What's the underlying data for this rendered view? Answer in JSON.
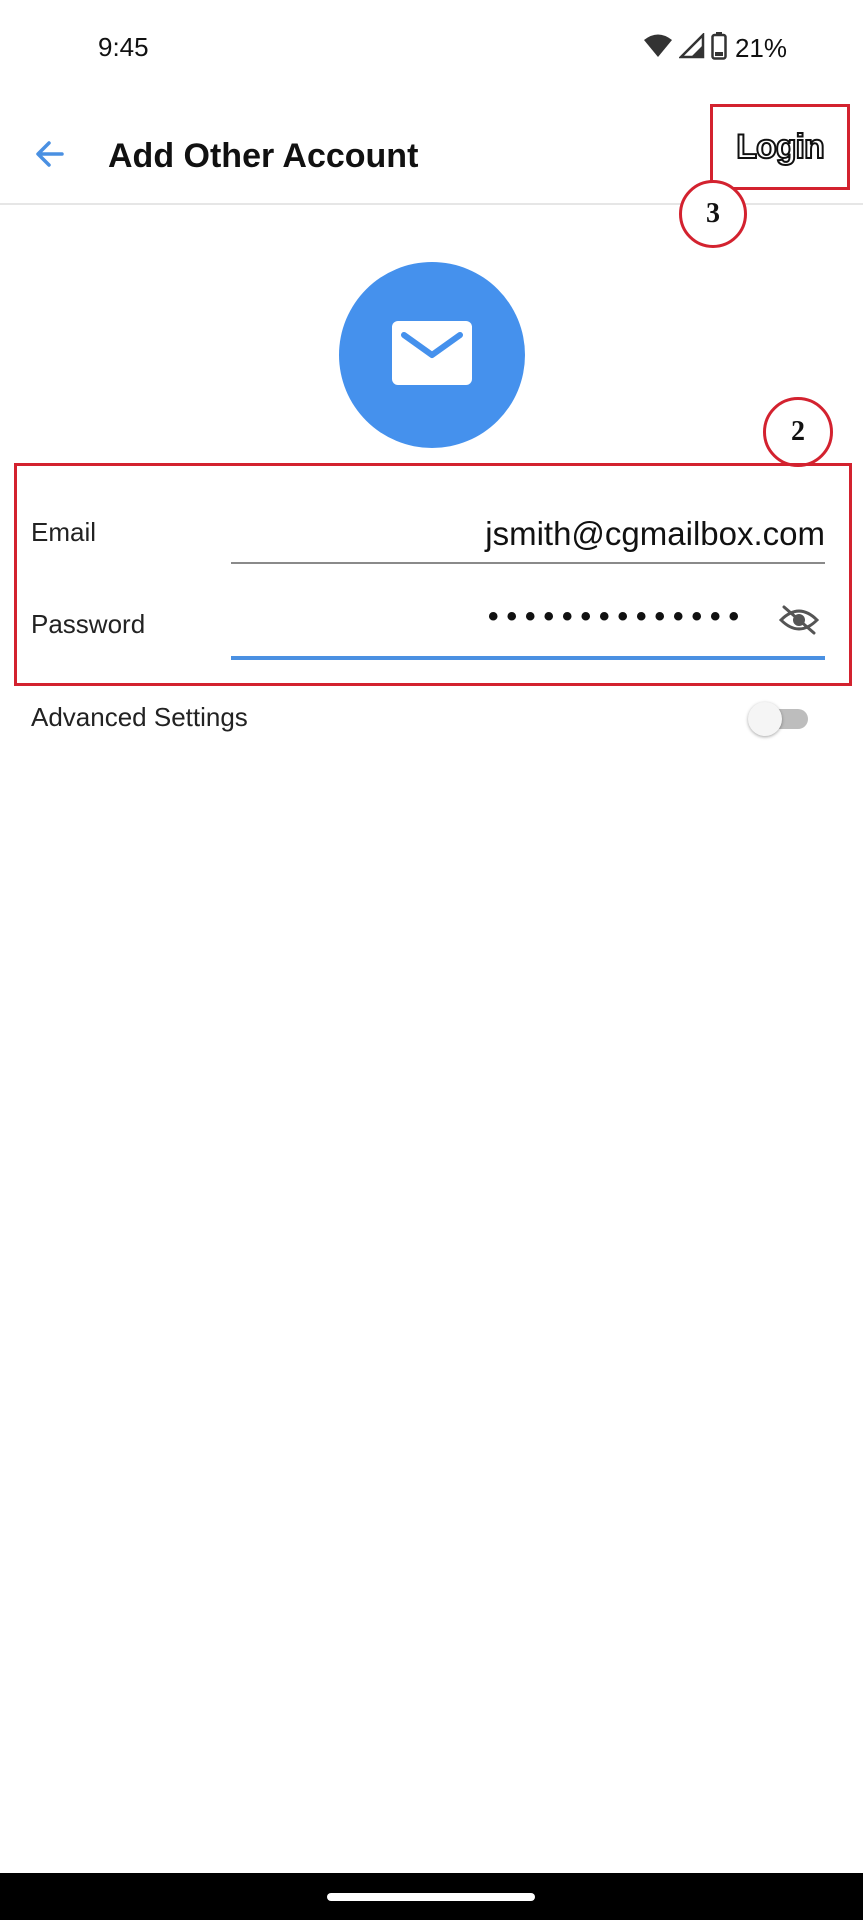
{
  "status_bar": {
    "time": "9:45",
    "battery_percent": "21%",
    "icons": [
      "wifi-icon",
      "signal-icon",
      "battery-icon"
    ]
  },
  "app_bar": {
    "back_icon": "arrow-left-icon",
    "title": "Add Other Account",
    "action_label": "Login"
  },
  "annotations": {
    "step_login": "3",
    "step_form": "2"
  },
  "avatar": {
    "icon": "envelope-icon",
    "color": "#4591ed"
  },
  "form": {
    "email_label": "Email",
    "email_value": "jsmith@cgmailbox.com",
    "password_label": "Password",
    "password_masked": "••••••••••••••",
    "password_visibility_icon": "eye-off-icon"
  },
  "advanced": {
    "label": "Advanced Settings",
    "enabled": false
  },
  "colors": {
    "accent": "#4a90e2",
    "annotation": "#d3222f"
  }
}
